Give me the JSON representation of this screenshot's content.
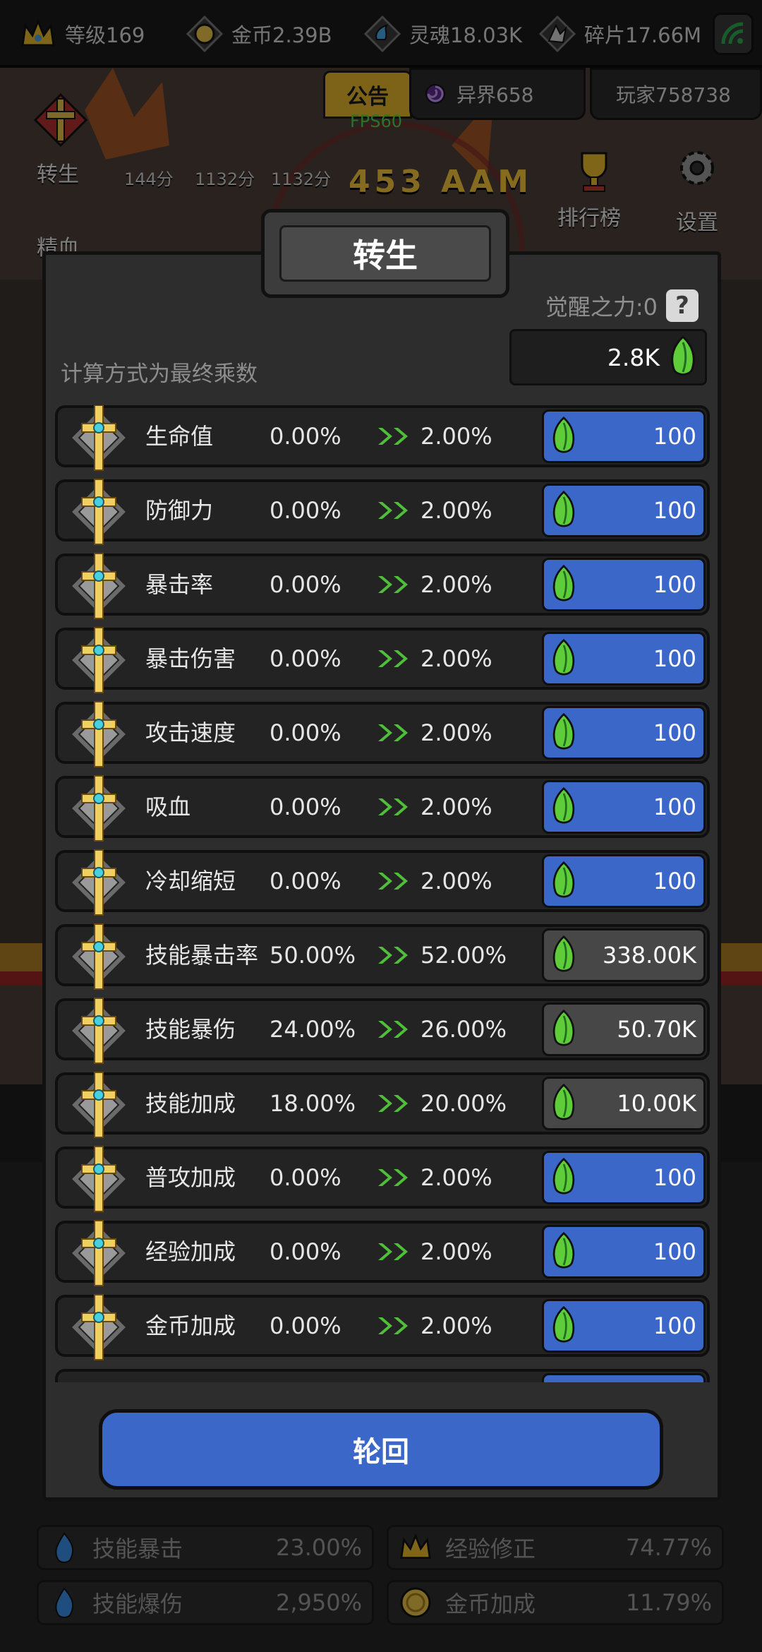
{
  "topbar": {
    "level": "等级169",
    "gold": "金币2.39B",
    "soul": "灵魂18.03K",
    "shard": "碎片17.66M"
  },
  "hud": {
    "notice": "公告",
    "fps": "FPS60",
    "otherworld": "异界658",
    "player": "玩家758738",
    "rebirth_label": "转生",
    "essence_label": "精血",
    "scores": [
      "144分",
      "1132分",
      "1132分"
    ],
    "big_damage": "453 AAM",
    "ranking_label": "排行榜",
    "settings_label": "设置"
  },
  "modal": {
    "title": "转生",
    "awaken_power": "觉醒之力:0",
    "help": "?",
    "calc_note": "计算方式为最终乘数",
    "balance": "2.8K",
    "confirm_label": "轮回",
    "rows": [
      {
        "name": "生命值",
        "current": "0.00%",
        "next": "2.00%",
        "cost": "100",
        "affordable": true
      },
      {
        "name": "防御力",
        "current": "0.00%",
        "next": "2.00%",
        "cost": "100",
        "affordable": true
      },
      {
        "name": "暴击率",
        "current": "0.00%",
        "next": "2.00%",
        "cost": "100",
        "affordable": true
      },
      {
        "name": "暴击伤害",
        "current": "0.00%",
        "next": "2.00%",
        "cost": "100",
        "affordable": true
      },
      {
        "name": "攻击速度",
        "current": "0.00%",
        "next": "2.00%",
        "cost": "100",
        "affordable": true
      },
      {
        "name": "吸血",
        "current": "0.00%",
        "next": "2.00%",
        "cost": "100",
        "affordable": true
      },
      {
        "name": "冷却缩短",
        "current": "0.00%",
        "next": "2.00%",
        "cost": "100",
        "affordable": true
      },
      {
        "name": "技能暴击率",
        "current": "50.00%",
        "next": "52.00%",
        "cost": "338.00K",
        "affordable": false
      },
      {
        "name": "技能暴伤",
        "current": "24.00%",
        "next": "26.00%",
        "cost": "50.70K",
        "affordable": false
      },
      {
        "name": "技能加成",
        "current": "18.00%",
        "next": "20.00%",
        "cost": "10.00K",
        "affordable": false
      },
      {
        "name": "普攻加成",
        "current": "0.00%",
        "next": "2.00%",
        "cost": "100",
        "affordable": true
      },
      {
        "name": "经验加成",
        "current": "0.00%",
        "next": "2.00%",
        "cost": "100",
        "affordable": true
      },
      {
        "name": "金币加成",
        "current": "0.00%",
        "next": "2.00%",
        "cost": "100",
        "affordable": true
      }
    ]
  },
  "bottom_stats": [
    {
      "label": "技能暴击",
      "value": "23.00%",
      "icon": "blue-flame-icon"
    },
    {
      "label": "经验修正",
      "value": "74.77%",
      "icon": "crown-icon"
    },
    {
      "label": "技能爆伤",
      "value": "2,950%",
      "icon": "blue-flame-icon"
    },
    {
      "label": "金币加成",
      "value": "11.79%",
      "icon": "gold-coin-icon"
    }
  ],
  "colors": {
    "accent_blue": "#3a67c8",
    "cost_gray": "#474747",
    "notice_gold": "#e3b52a",
    "fps_green": "#4fd04f",
    "crystal_green": "#5fcc3a"
  }
}
